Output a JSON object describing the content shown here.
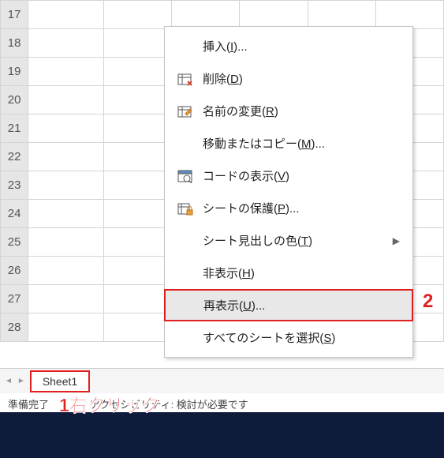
{
  "rows": [
    "17",
    "18",
    "19",
    "20",
    "21",
    "22",
    "23",
    "24",
    "25",
    "26",
    "27",
    "28"
  ],
  "tabs": {
    "sheet1": "Sheet1"
  },
  "status": {
    "text": "準備完了　　　　アクセシビリティ: 検討が必要です"
  },
  "menu": {
    "insert": "挿入(I)...",
    "delete": "削除(D)",
    "rename": "名前の変更(R)",
    "move": "移動またはコピー(M)...",
    "viewcode": "コードの表示(V)",
    "protect": "シートの保護(P)...",
    "tabcolor": "シート見出しの色(T)",
    "hide": "非表示(H)",
    "unhide": "再表示(U)...",
    "selectall": "すべてのシートを選択(S)"
  },
  "annot": {
    "one": "1右クリック",
    "two": "2"
  }
}
